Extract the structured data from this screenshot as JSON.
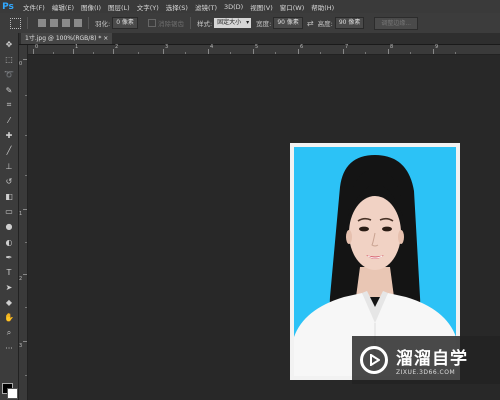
{
  "app": {
    "logo": "Ps"
  },
  "menu": [
    "文件(F)",
    "编辑(E)",
    "图像(I)",
    "图层(L)",
    "文字(Y)",
    "选择(S)",
    "滤镜(T)",
    "3D(D)",
    "视图(V)",
    "窗口(W)",
    "帮助(H)"
  ],
  "options": {
    "feather_label": "羽化:",
    "feather_value": "0 像素",
    "antialias_label": "消除锯齿",
    "style_label": "样式:",
    "style_value": "固定大小",
    "width_label": "宽度:",
    "width_value": "90 像素",
    "height_label": "高度:",
    "height_value": "90 像素",
    "refine_edge": "调整边缘..."
  },
  "document": {
    "tab_label": "1寸.jpg @ 100%(RGB/8) * ×"
  },
  "ruler": {
    "top_numbers": [
      "0",
      "1",
      "2",
      "3",
      "4",
      "5",
      "6",
      "7",
      "8",
      "9"
    ],
    "left_numbers": [
      "0",
      "1",
      "2",
      "3"
    ]
  },
  "tools": [
    "move-tool-icon",
    "marquee-tool-icon",
    "lasso-tool-icon",
    "quick-select-tool-icon",
    "crop-tool-icon",
    "eyedropper-tool-icon",
    "healing-brush-icon",
    "brush-tool-icon",
    "clone-stamp-icon",
    "history-brush-icon",
    "eraser-tool-icon",
    "gradient-tool-icon",
    "blur-tool-icon",
    "dodge-tool-icon",
    "pen-tool-icon",
    "type-tool-icon",
    "path-select-icon",
    "shape-tool-icon",
    "hand-tool-icon",
    "zoom-tool-icon"
  ],
  "watermark": {
    "main": "溜溜自学",
    "sub": "ZIXUE.3D66.COM"
  },
  "colors": {
    "photo_background": "#2cc2f6",
    "foreground": "#000000",
    "background": "#ffffff",
    "ps_blue": "#31a8ff"
  }
}
